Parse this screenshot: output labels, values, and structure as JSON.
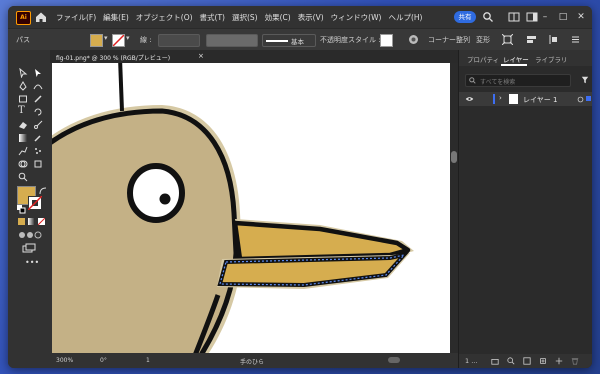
{
  "menubar": {
    "app_logo": "Ai",
    "items": [
      "ファイル(F)",
      "編集(E)",
      "オブジェクト(O)",
      "書式(T)",
      "選択(S)",
      "効果(C)",
      "表示(V)",
      "ウィンドウ(W)",
      "ヘルプ(H)"
    ],
    "share_label": "共有"
  },
  "control_bar": {
    "selection_label": "パス",
    "stroke_label": "線 :",
    "stroke_profile": "基本",
    "opacity_label": "不透明度",
    "style_label": "スタイル :",
    "anchor_label": "コーナー",
    "align_label": "整列",
    "transform_label": "変形",
    "fill_color": "#d6ad4f"
  },
  "document": {
    "tab_title": "fig-01.png* @ 300 % (RGB/プレビュー)",
    "zoom": "300%",
    "rotation": "0°",
    "artboard": "1",
    "status_tool": "手のひら"
  },
  "panel": {
    "tabs": [
      "プロパティ",
      "レイヤー",
      "ライブラリ"
    ],
    "active_tab": "レイヤー",
    "search_placeholder": "すべてを検索",
    "layers": [
      {
        "name": "レイヤー 1"
      }
    ],
    "layer_count": "1 ..."
  },
  "artwork": {
    "head_color": "#c4b186",
    "beak_color": "#d6ad4f",
    "outline_color": "#111111",
    "highlight_color": "#5d8bf0"
  }
}
